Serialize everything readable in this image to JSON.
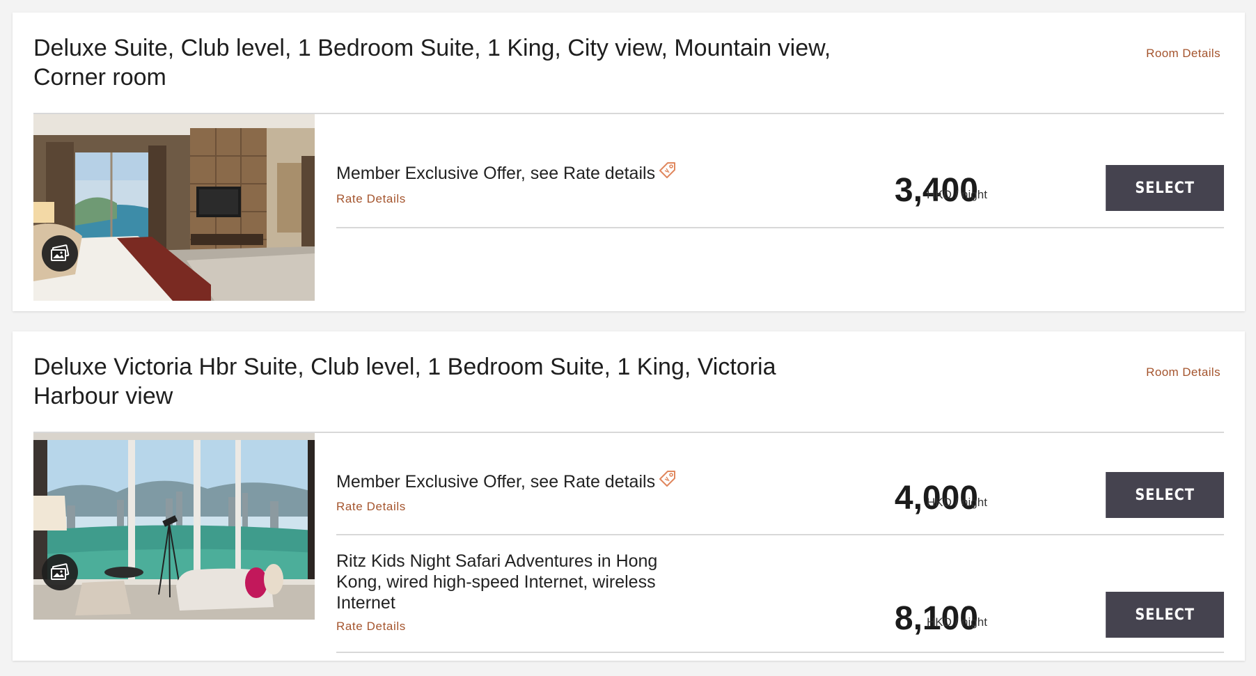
{
  "rooms": [
    {
      "title": "Deluxe Suite, Club level, 1 Bedroom Suite, 1 King, City view, Mountain view, Corner room",
      "room_details_label": "Room Details",
      "photo_icon": "bedroom-photo",
      "gallery_icon": "gallery-icon",
      "rates": [
        {
          "offer": "Member Exclusive Offer, see Rate details",
          "offer_icon": "tag-icon",
          "rate_details_label": "Rate Details",
          "price": "3,400",
          "unit": "HKD / night",
          "select_label": "SELECT"
        }
      ]
    },
    {
      "title": "Deluxe Victoria Hbr Suite, Club level, 1 Bedroom Suite, 1 King, Victoria Harbour view",
      "room_details_label": "Room Details",
      "photo_icon": "harbour-view-photo",
      "gallery_icon": "gallery-icon",
      "rates": [
        {
          "offer": "Member Exclusive Offer, see Rate details",
          "offer_icon": "tag-icon",
          "rate_details_label": "Rate Details",
          "price": "4,000",
          "unit": "HKD / night",
          "select_label": "SELECT"
        },
        {
          "offer": "Ritz Kids Night Safari Adventures in Hong Kong, wired high-speed Internet, wireless Internet",
          "rate_details_label": "Rate Details",
          "price": "8,100",
          "unit": "HKD / night",
          "select_label": "SELECT"
        }
      ]
    }
  ],
  "colors": {
    "accent": "#a4542d",
    "button": "#45434f",
    "divider": "#d8d8d8",
    "background": "#f3f3f3"
  }
}
